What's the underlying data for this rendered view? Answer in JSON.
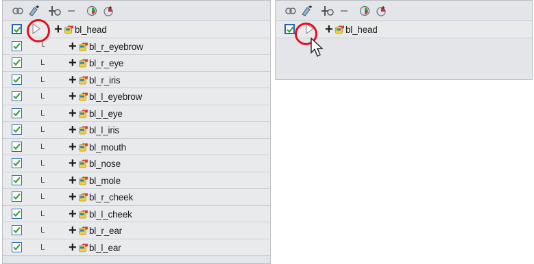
{
  "toolbar_icons": [
    "onion-skin-icon",
    "add-drawing-icon",
    "add-layer-icon",
    "remove-layer-icon",
    "peg-icon",
    "add-peg-icon"
  ],
  "left_panel": {
    "layers": [
      {
        "label": "bl_head",
        "level": 0
      },
      {
        "label": "bl_r_eyebrow",
        "level": 1
      },
      {
        "label": "bl_r_eye",
        "level": 1
      },
      {
        "label": "bl_r_iris",
        "level": 1
      },
      {
        "label": "bl_l_eyebrow",
        "level": 1
      },
      {
        "label": "bl_l_eye",
        "level": 1
      },
      {
        "label": "bl_l_iris",
        "level": 1
      },
      {
        "label": "bl_mouth",
        "level": 1
      },
      {
        "label": "bl_nose",
        "level": 1
      },
      {
        "label": "bl_mole",
        "level": 1
      },
      {
        "label": "bl_r_cheek",
        "level": 1
      },
      {
        "label": "bl_l_cheek",
        "level": 1
      },
      {
        "label": "bl_r_ear",
        "level": 1
      },
      {
        "label": "bl_l_ear",
        "level": 1
      }
    ]
  },
  "right_panel": {
    "layers": [
      {
        "label": "bl_head",
        "level": 0
      }
    ]
  },
  "colors": {
    "highlight": "#e3101c",
    "check": "#3aa23a",
    "panel": "#e3e5e8"
  }
}
